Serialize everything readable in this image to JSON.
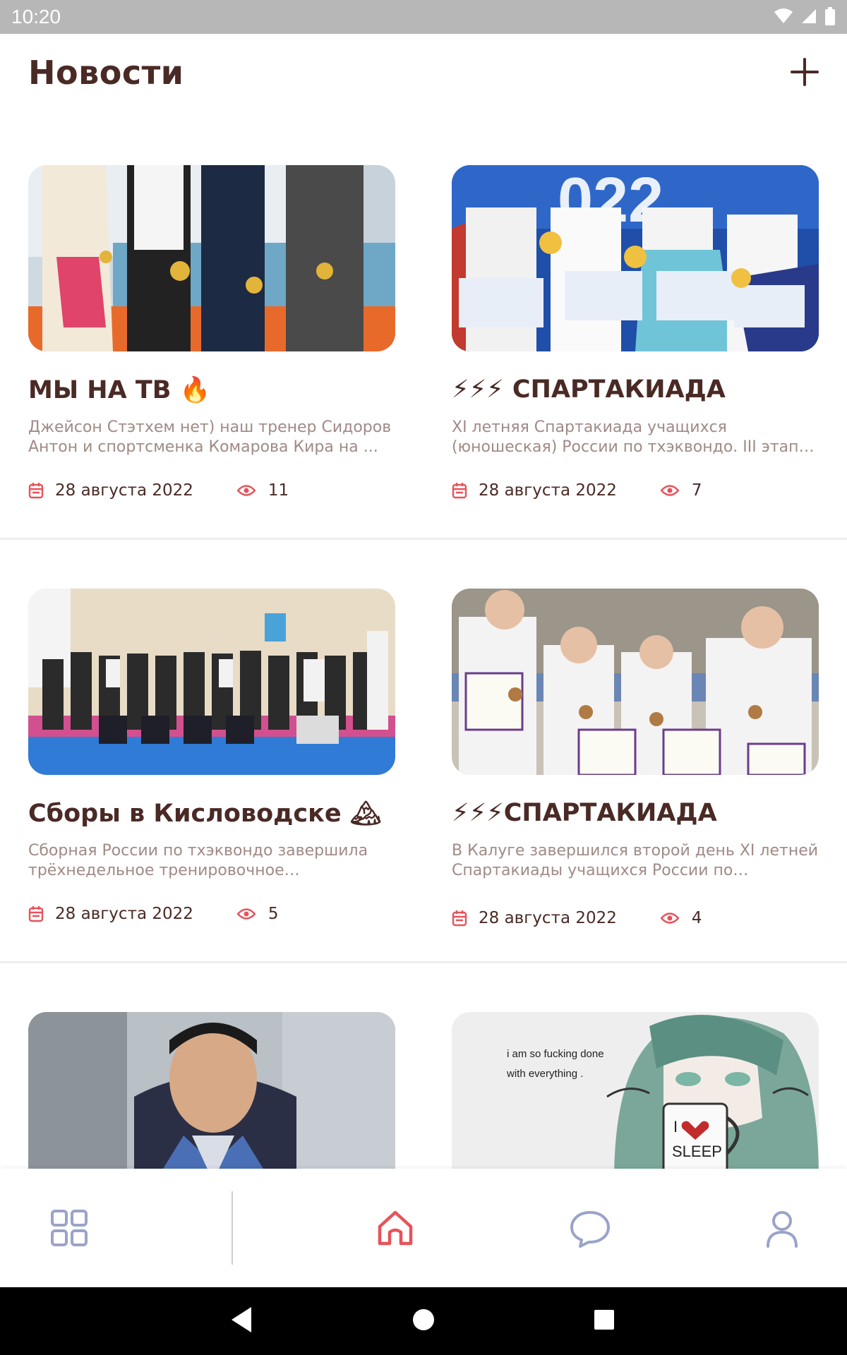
{
  "status_bar": {
    "time": "10:20"
  },
  "header": {
    "title": "Новости"
  },
  "news": [
    {
      "title": "МЫ НА ТВ 🔥",
      "description": "Джейсон Стэтхем нет) наш тренер Сидоров Антон и спортсменка Комарова Кира на ...",
      "date": "28 августа 2022",
      "views": "11"
    },
    {
      "title": "⚡⚡⚡ СПАРТАКИАДА",
      "description": "XI летняя Спартакиада учащихся (юношеская) России по тхэквондо. III этап (финал). Калуга...",
      "date": "28 августа 2022",
      "views": "7"
    },
    {
      "title": "Сборы в Кисловодске 🏔",
      "description": "Сборная России по тхэквондо завершила трёхнедельное тренировочное мероприяти...",
      "date": "28 августа 2022",
      "views": "5"
    },
    {
      "title": "⚡⚡⚡СПАРТАКИАДА",
      "description": "В Калуге завершился второй день XI летней Спартакиады учащихся России по тхэквондо.",
      "date": "28 августа 2022",
      "views": "4"
    }
  ],
  "partial_images": {
    "meme_caption_line1": "i am so fucking done",
    "meme_caption_line2": "with everything .",
    "mug_text_1": "I",
    "mug_text_2": "SLEEP"
  },
  "colors": {
    "accent": "#e8525a",
    "text": "#4a2a25",
    "muted": "#a08a86",
    "nav_icon": "#9aa3c8"
  }
}
